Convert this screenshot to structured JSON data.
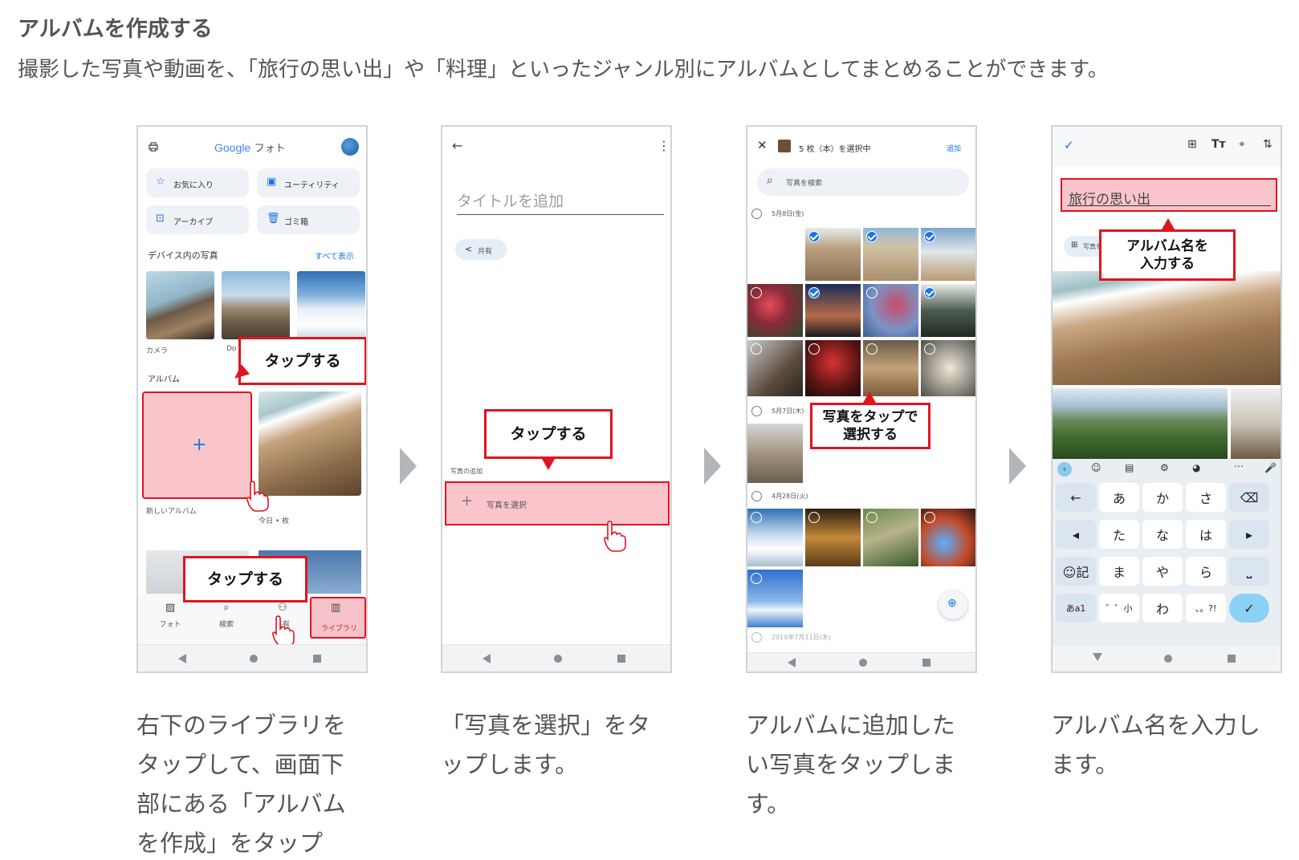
{
  "header": {
    "title": "アルバムを作成する",
    "subtitle": "撮影した写真や動画を、「旅行の思い出」や「料理」といったジャンル別にアルバムとしてまとめることができます。"
  },
  "step1": {
    "app_title_google": "Google",
    "app_title_photos": "フォト",
    "chips": [
      "お気に入り",
      "ユーティリティ",
      "アーカイブ",
      "ゴミ箱"
    ],
    "device_photos_label": "デバイス内の写真",
    "see_all_label": "すべて表示",
    "folders": [
      "カメラ",
      "Do"
    ],
    "albums_label": "アルバム",
    "new_album_label": "新しいアルバム",
    "album_count": "今日 • 枚",
    "bottom_nav": [
      "フォト",
      "検索",
      "共有",
      "ライブラリ"
    ],
    "callouts": [
      "タップする",
      "タップする"
    ]
  },
  "step2": {
    "title_placeholder": "タイトルを追加",
    "share_label": "共有",
    "add_photos_label": "写真の追加",
    "select_photos_label": "写真を選択",
    "callout": "タップする"
  },
  "step3": {
    "selection_status": "5 枚（本）を選択中",
    "add_label": "追加",
    "search_placeholder": "写真を検索",
    "dates": [
      "5月8日(金)",
      "5月7日(木)",
      "4月28日(火)",
      "2019年7月11日(木)"
    ],
    "callout_line1": "写真をタップで",
    "callout_line2": "選択する"
  },
  "step4": {
    "album_name_value": "旅行の思い出",
    "add_photo_chip": "写真を追加",
    "callout_line1": "アルバム名を",
    "callout_line2": "入力する",
    "keyboard_rows": [
      [
        "←",
        "あ",
        "か",
        "さ",
        "⌫"
      ],
      [
        "◂",
        "た",
        "な",
        "は",
        "▸"
      ],
      [
        "☺記",
        "ま",
        "や",
        "ら",
        "⎵"
      ],
      [
        "あa1",
        "゛゜小",
        "わ",
        "、。?!",
        "✓"
      ]
    ]
  },
  "captions": [
    [
      "右下のライブラリを",
      "タップして、画面下",
      "部にある「アルバム",
      "を作成」をタップ"
    ],
    [
      "「写真を選択」をタ",
      "ップします。"
    ],
    [
      "アルバムに追加した",
      "い写真をタップしま",
      "す。"
    ],
    [
      "アルバム名を入力し",
      "ます。"
    ]
  ],
  "colors": {
    "accent_red": "#e0141f",
    "highlight_pink": "#f4a0aa",
    "google_blue": "#1a73e8",
    "arrow_gray": "#b3b6b9"
  }
}
